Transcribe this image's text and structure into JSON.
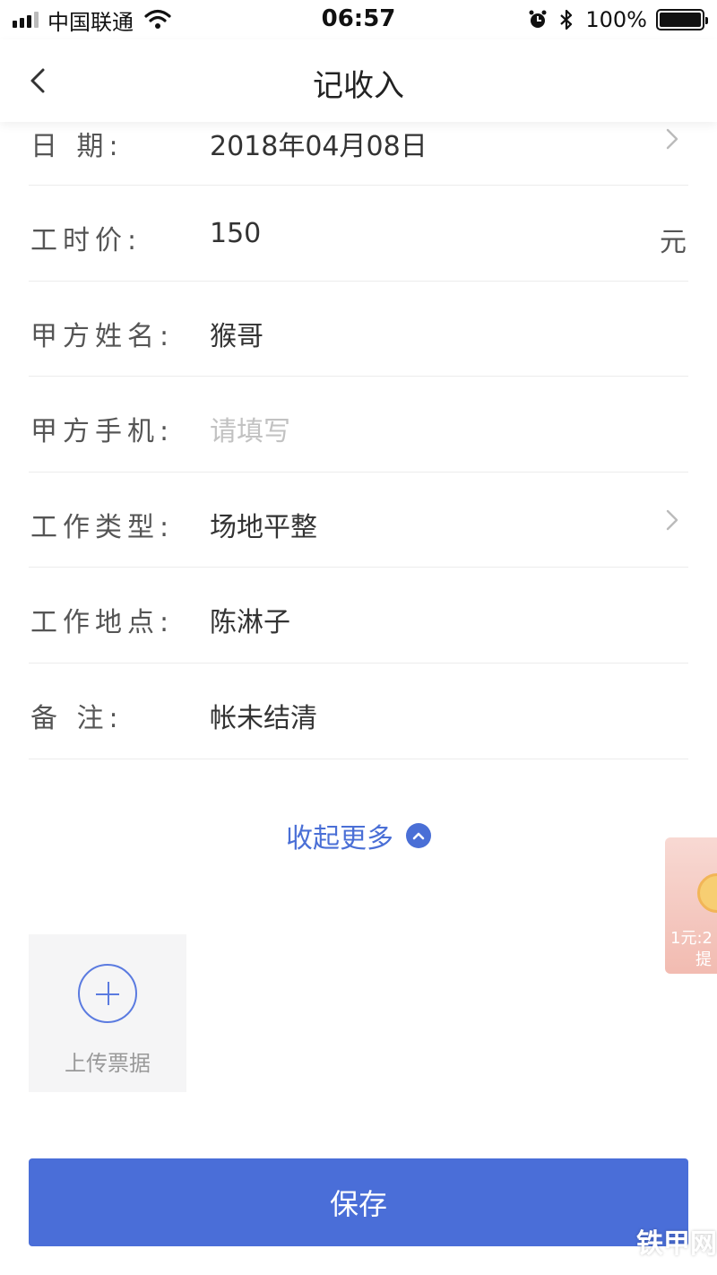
{
  "status_bar": {
    "carrier": "中国联通",
    "time": "06:57",
    "battery_pct": "100%"
  },
  "nav": {
    "title": "记收入",
    "back_icon": "chevron-left-icon"
  },
  "form": {
    "date": {
      "label": "日 期:",
      "value": "2018年04月08日"
    },
    "hourly_price": {
      "label": "工时价:",
      "value": "150",
      "suffix": "元"
    },
    "client_name": {
      "label": "甲方姓名:",
      "value": "猴哥"
    },
    "client_phone": {
      "label": "甲方手机:",
      "placeholder": "请填写"
    },
    "work_type": {
      "label": "工作类型:",
      "value": "场地平整"
    },
    "work_location": {
      "label": "工作地点:",
      "value": "陈淋子"
    },
    "remark": {
      "label": "备 注:",
      "value": "帐未结清"
    }
  },
  "collapse": {
    "label": "收起更多"
  },
  "upload": {
    "label": "上传票据"
  },
  "float_ad": {
    "line1": "1元:2",
    "line2": "提"
  },
  "save": {
    "label": "保存"
  },
  "watermark": "铁甲网",
  "colors": {
    "accent": "#4a6ed8",
    "link": "#4a6fd6",
    "placeholder": "#c2c2c2"
  }
}
